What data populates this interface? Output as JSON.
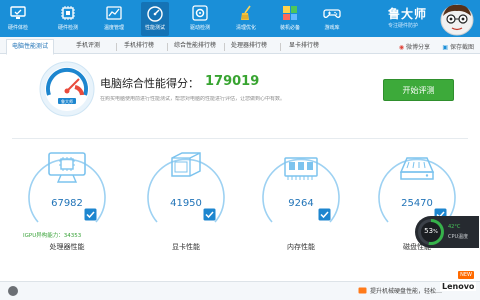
{
  "app": {
    "brand_name": "鲁大师",
    "brand_tagline": "专注硬件防护"
  },
  "nav": {
    "items": [
      {
        "label": "硬件体检",
        "icon": "monitor-check-icon"
      },
      {
        "label": "硬件检测",
        "icon": "chip-icon"
      },
      {
        "label": "温度管理",
        "icon": "thermometer-icon"
      },
      {
        "label": "性能测试",
        "icon": "speedometer-icon",
        "active": true
      },
      {
        "label": "驱动检测",
        "icon": "driver-gear-icon"
      },
      {
        "label": "清理优化",
        "icon": "broom-icon"
      },
      {
        "label": "装机必备",
        "icon": "package-icon"
      },
      {
        "label": "游戏库",
        "icon": "gamepad-icon"
      }
    ]
  },
  "tabs": {
    "items": [
      {
        "label": "电脑性能测试",
        "active": true
      },
      {
        "label": "手机评测"
      },
      {
        "label": "手机排行榜"
      },
      {
        "label": "综合性能排行榜"
      },
      {
        "label": "处理器排行榜"
      },
      {
        "label": "显卡排行榜"
      }
    ],
    "share_label": "微博分享",
    "save_label": "保存截图"
  },
  "hero": {
    "score_label": "电脑综合性能得分：",
    "score_value": "179019",
    "description": "在购买电脑使用前进行性能测试，帮您对电脑的性能进行评估，让您做到心中有数。",
    "evaluate_button": "开始评测",
    "gauge_badge": "鲁大师"
  },
  "cards": [
    {
      "label": "处理器性能",
      "score": "67982",
      "icon": "cpu-monitor-icon"
    },
    {
      "label": "显卡性能",
      "score": "41950",
      "icon": "graphics-card-icon"
    },
    {
      "label": "内存性能",
      "score": "9264",
      "icon": "memory-chip-icon"
    },
    {
      "label": "磁盘性能",
      "score": "25470",
      "icon": "hard-disk-icon"
    }
  ],
  "igpu": {
    "label": "IGPU异构能力：",
    "value": "34353"
  },
  "cpu_widget": {
    "percent": "53",
    "percent_unit": "%",
    "temperature": "42°C",
    "label": "CPU温度"
  },
  "badge_new": "NEW",
  "bottom": {
    "tip": "提升机械硬盘性能，轻松…"
  },
  "watermark": "Lenovo",
  "colors": {
    "primary": "#1a8fd8",
    "accent_green": "#3daa3a",
    "score_blue": "#2274b8"
  }
}
